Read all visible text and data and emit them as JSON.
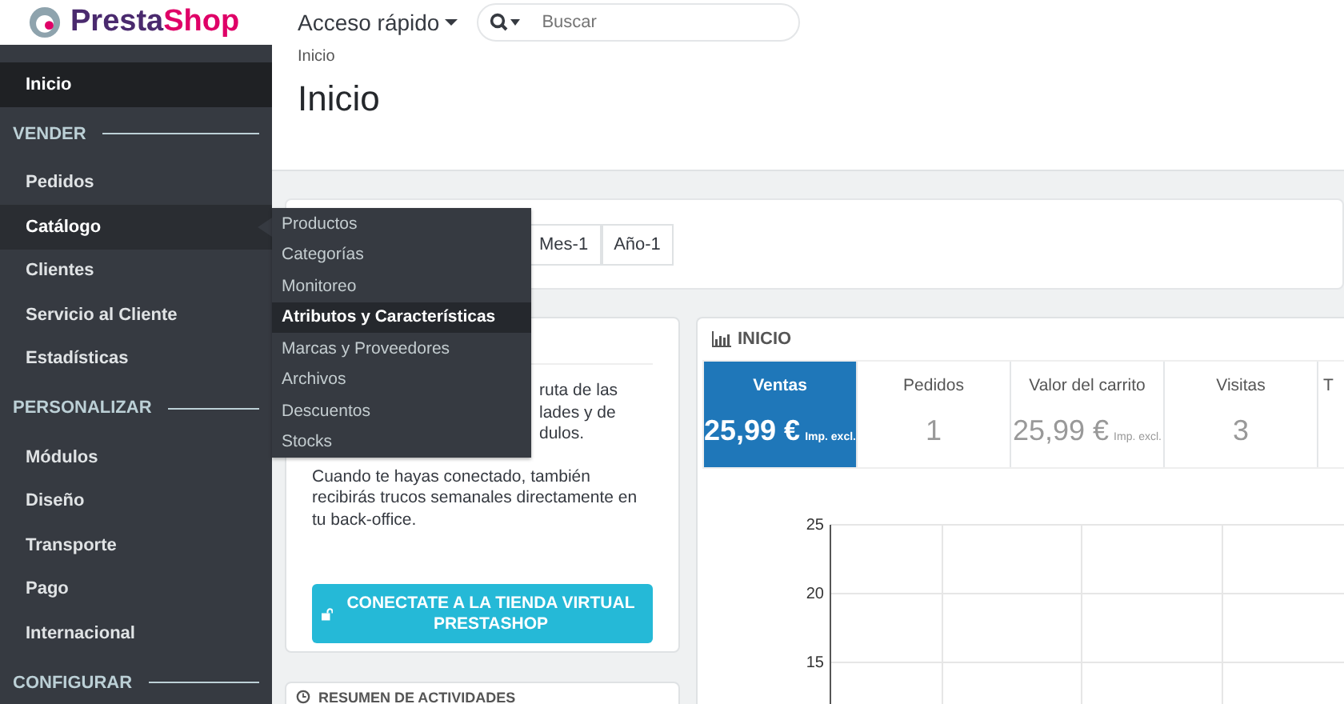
{
  "header": {
    "logo": {
      "part_1": "Presta",
      "part_2": "Shop"
    },
    "quick_access": "Acceso rápido",
    "search": {
      "placeholder": "Buscar"
    }
  },
  "sidebar": {
    "groups": [
      {
        "items": [
          {
            "label": "Inicio",
            "selected": true,
            "expanded": false
          }
        ]
      },
      {
        "heading": "VENDER",
        "items": [
          {
            "label": "Pedidos",
            "selected": false,
            "expanded": false
          },
          {
            "label": "Catálogo",
            "selected": false,
            "expanded": true
          },
          {
            "label": "Clientes",
            "selected": false,
            "expanded": false
          },
          {
            "label": "Servicio al Cliente",
            "selected": false,
            "expanded": false
          },
          {
            "label": "Estadísticas",
            "selected": false,
            "expanded": false
          }
        ]
      },
      {
        "heading": "PERSONALIZAR",
        "items": [
          {
            "label": "Módulos",
            "selected": false,
            "expanded": false
          },
          {
            "label": "Diseño",
            "selected": false,
            "expanded": false
          },
          {
            "label": "Transporte",
            "selected": false,
            "expanded": false
          },
          {
            "label": "Pago",
            "selected": false,
            "expanded": false
          },
          {
            "label": "Internacional",
            "selected": false,
            "expanded": false
          }
        ]
      },
      {
        "heading": "CONFIGURAR"
      }
    ]
  },
  "submenu": [
    {
      "label": "Productos",
      "selected": false
    },
    {
      "label": "Categorías",
      "selected": false
    },
    {
      "label": "Monitoreo",
      "selected": false
    },
    {
      "label": "Atributos y Características",
      "selected": true
    },
    {
      "label": "Marcas y Proveedores",
      "selected": false
    },
    {
      "label": "Archivos",
      "selected": false
    },
    {
      "label": "Descuentos",
      "selected": false
    },
    {
      "label": "Stocks",
      "selected": false
    }
  ],
  "breadcrumb": "Inicio",
  "page_title": "Inicio",
  "period_buttons": [
    "Mes-1",
    "Año-1"
  ],
  "addons_card": {
    "fragments": [
      "ruta de las",
      "lades y de",
      "dulos."
    ],
    "text": "Cuando te hayas conectado, también recibirás trucos semanales directamente en tu back-office.",
    "button": "CONECTATE A LA TIENDA VIRTUAL PRESTASHOP"
  },
  "activity_card": {
    "title": "RESUMEN DE ACTIVIDADES"
  },
  "dashboard": {
    "title": "INICIO",
    "kpis": [
      {
        "label": "Ventas",
        "value": "25,99 €",
        "suffix": "Imp. excl.",
        "selected": true
      },
      {
        "label": "Pedidos",
        "value": "1",
        "selected": false
      },
      {
        "label": "Valor del carrito",
        "value": "25,99 €",
        "suffix": "Imp. excl.",
        "selected": false
      },
      {
        "label": "Visitas",
        "value": "3",
        "selected": false
      },
      {
        "label": "T",
        "selected": false
      }
    ],
    "chart_axis_labels": [
      "25",
      "20",
      "15"
    ]
  }
}
